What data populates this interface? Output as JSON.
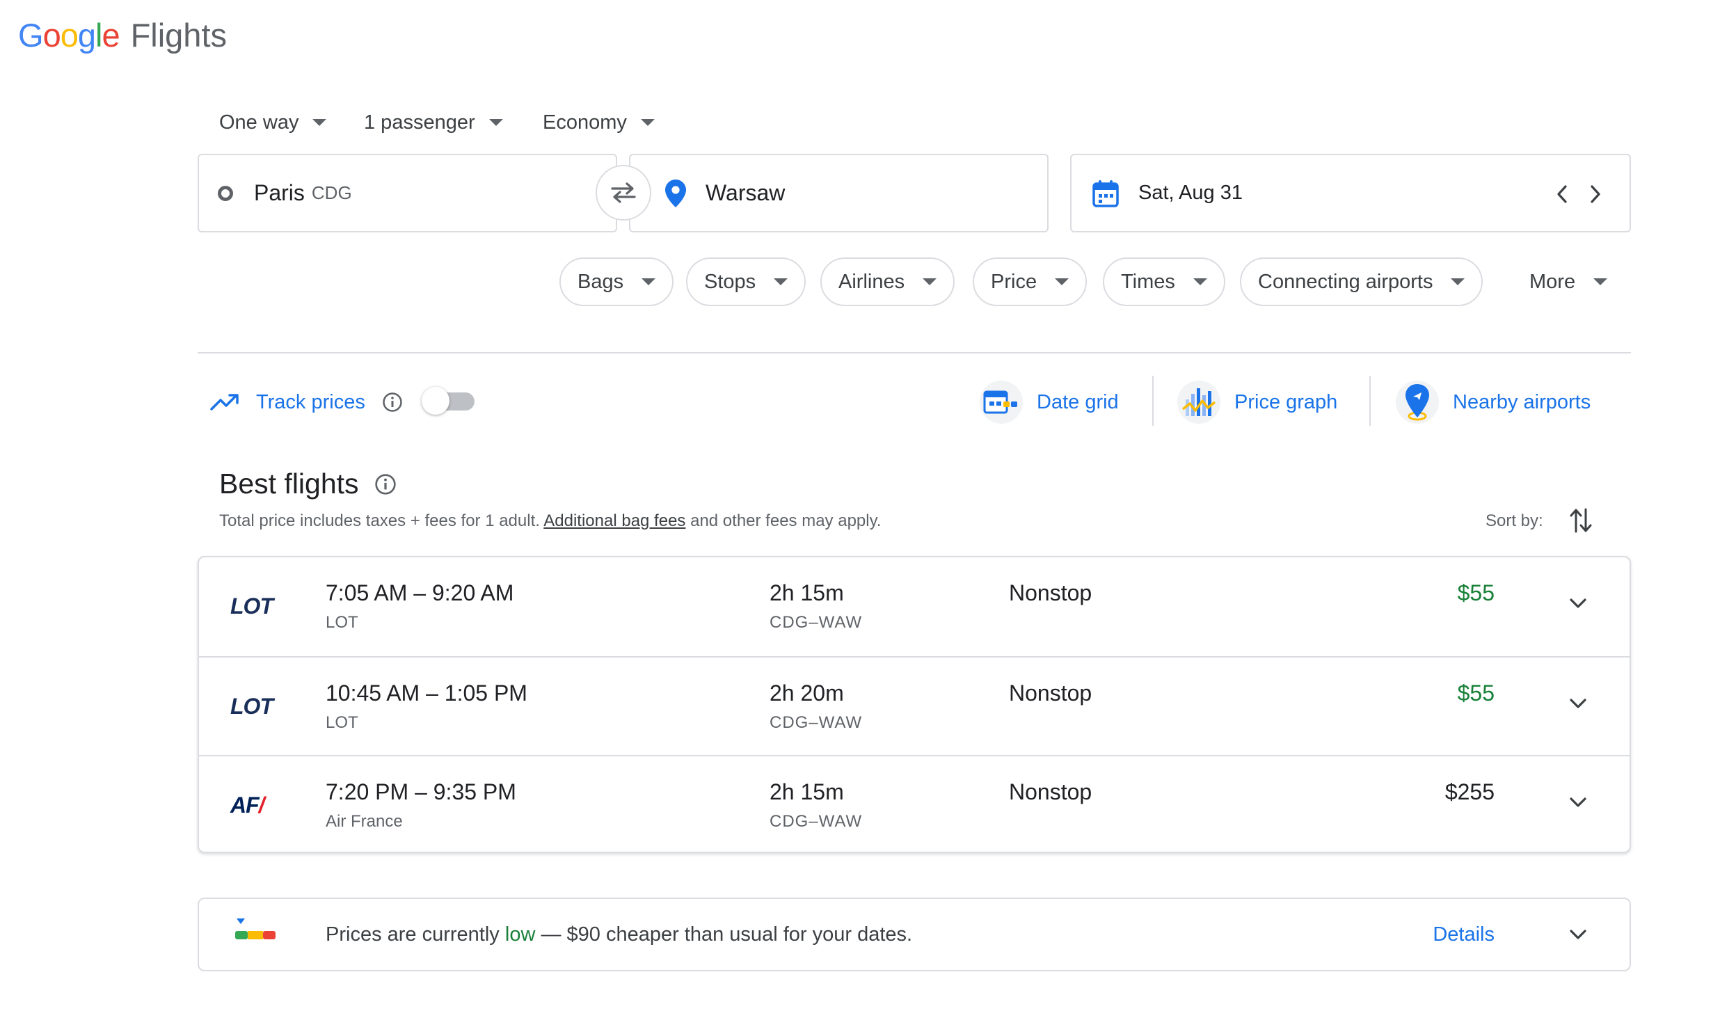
{
  "app": {
    "logo_text": "Google",
    "product": "Flights"
  },
  "trip_options": {
    "trip_type": "One way",
    "passengers": "1 passenger",
    "cabin": "Economy"
  },
  "search": {
    "origin_city": "Paris",
    "origin_code": "CDG",
    "destination": "Warsaw",
    "date": "Sat, Aug 31"
  },
  "filters": [
    "Bags",
    "Stops",
    "Airlines",
    "Price",
    "Times",
    "Connecting airports",
    "More"
  ],
  "tools": {
    "track_prices": "Track prices",
    "date_grid": "Date grid",
    "price_graph": "Price graph",
    "nearby_airports": "Nearby airports"
  },
  "results": {
    "title": "Best flights",
    "note_before": "Total price includes taxes + fees for 1 adult.",
    "note_link": "Additional bag fees",
    "note_after": "and other fees may apply.",
    "sort_label": "Sort by:",
    "flights": [
      {
        "logo": "LOT",
        "times": "7:05 AM – 9:20 AM",
        "airline": "LOT",
        "duration": "2h 15m",
        "route": "CDG–WAW",
        "stops": "Nonstop",
        "price": "$55"
      },
      {
        "logo": "LOT",
        "times": "10:45 AM – 1:05 PM",
        "airline": "LOT",
        "duration": "2h 20m",
        "route": "CDG–WAW",
        "stops": "Nonstop",
        "price": "$55"
      },
      {
        "logo": "AF",
        "times": "7:20 PM – 9:35 PM",
        "airline": "Air France",
        "duration": "2h 15m",
        "route": "CDG–WAW",
        "stops": "Nonstop",
        "price": "$255"
      }
    ]
  },
  "insight": {
    "prefix": "Prices are currently",
    "level": "low",
    "suffix": "— $90 cheaper than usual for your dates.",
    "details": "Details"
  },
  "colors": {
    "accent": "#1a73e8",
    "low_price": "#188038",
    "border": "#dadce0"
  }
}
